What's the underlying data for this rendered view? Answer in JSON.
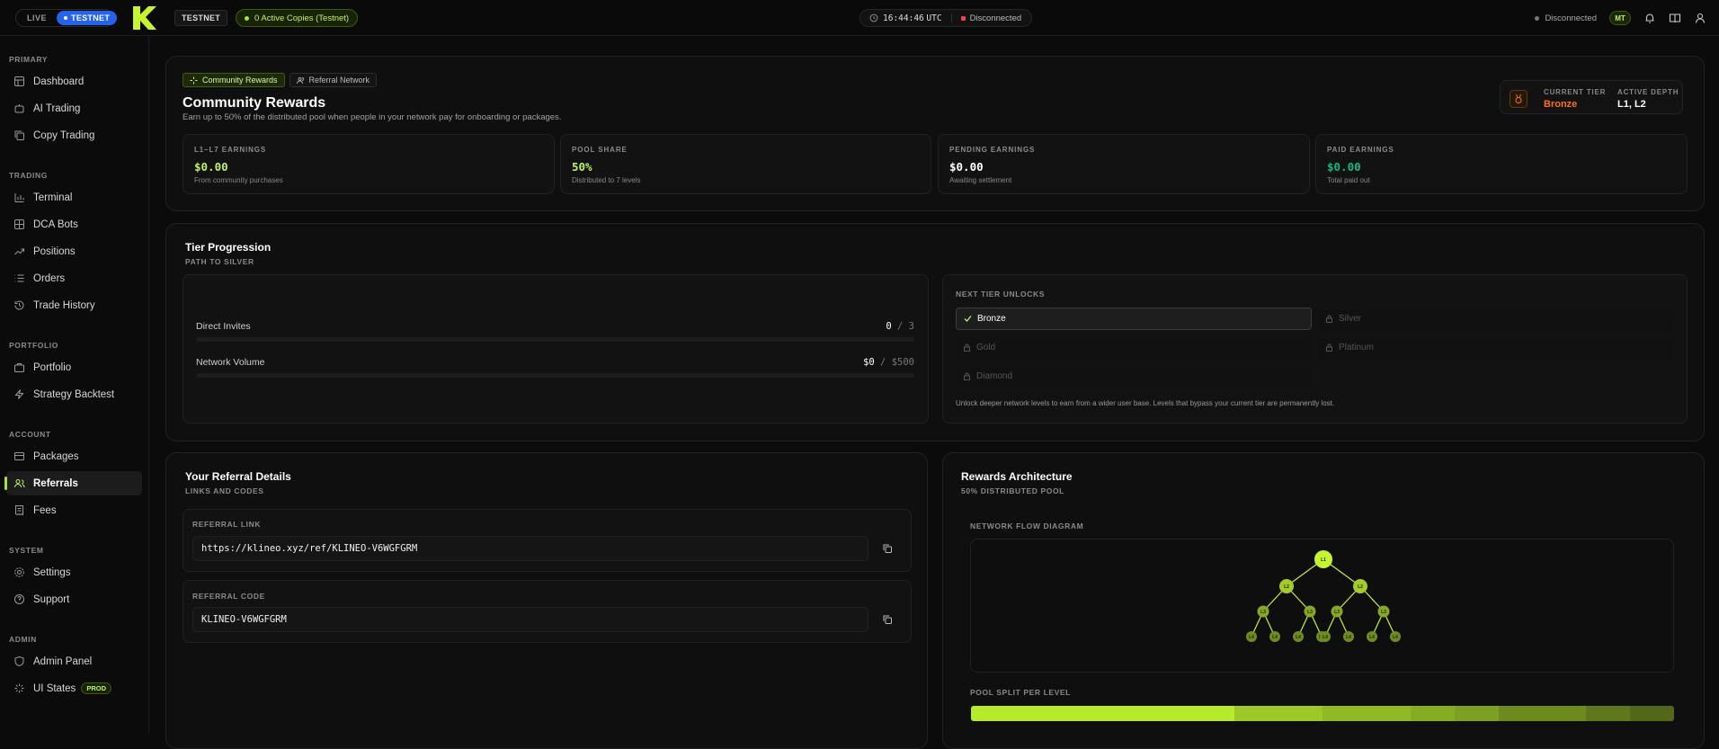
{
  "topbar": {
    "mode_live": "LIVE",
    "mode_testnet": "TESTNET",
    "network_badge": "TESTNET",
    "copies_badge": "0 Active Copies (Testnet)",
    "clock_time": "16:44:46",
    "clock_tz": "UTC",
    "connection": "Disconnected",
    "right_status": "Disconnected",
    "user_badge": "MT"
  },
  "sidebar": {
    "sections": [
      {
        "title": "PRIMARY",
        "items": [
          "Dashboard",
          "AI Trading",
          "Copy Trading"
        ]
      },
      {
        "title": "TRADING",
        "items": [
          "Terminal",
          "DCA Bots",
          "Positions",
          "Orders",
          "Trade History"
        ]
      },
      {
        "title": "PORTFOLIO",
        "items": [
          "Portfolio",
          "Strategy Backtest"
        ]
      },
      {
        "title": "ACCOUNT",
        "items": [
          "Packages",
          "Referrals",
          "Fees"
        ]
      },
      {
        "title": "SYSTEM",
        "items": [
          "Settings",
          "Support"
        ]
      },
      {
        "title": "ADMIN",
        "items": [
          "Admin Panel",
          "UI States"
        ]
      }
    ],
    "active_item": "Referrals",
    "prod_badge": "PROD"
  },
  "header": {
    "tab_community": "Community Rewards",
    "tab_network": "Referral Network",
    "title": "Community Rewards",
    "subtitle": "Earn up to 50% of the distributed pool when people in your network pay for onboarding or packages.",
    "current_tier_label": "CURRENT TIER",
    "current_tier": "Bronze",
    "active_depth_label": "ACTIVE DEPTH",
    "active_depth": "L1, L2"
  },
  "stats": [
    {
      "label": "L1–L7 EARNINGS",
      "value": "$0.00",
      "sub": "From community purchases",
      "color": "#bef264"
    },
    {
      "label": "POOL SHARE",
      "value": "50%",
      "sub": "Distributed to 7 levels",
      "color": "#bef264"
    },
    {
      "label": "PENDING EARNINGS",
      "value": "$0.00",
      "sub": "Awaiting settlement",
      "color": "#ffffff"
    },
    {
      "label": "PAID EARNINGS",
      "value": "$0.00",
      "sub": "Total paid out",
      "color": "#10b981"
    }
  ],
  "tier_progression": {
    "title": "Tier Progression",
    "subtitle": "PATH TO SILVER",
    "direct_invites_label": "Direct Invites",
    "direct_invites_value": "0",
    "direct_invites_target": "3",
    "direct_invites_progress": 0,
    "network_volume_label": "Network Volume",
    "network_volume_value": "$0",
    "network_volume_target": "$500",
    "network_volume_progress": 0,
    "next_unlocks_title": "NEXT TIER UNLOCKS",
    "unlocks": [
      "Bronze",
      "Silver",
      "Gold",
      "Platinum",
      "Diamond"
    ],
    "note": "Unlock deeper network levels to earn from a wider user base. Levels that bypass your current tier are permanently lost."
  },
  "referral": {
    "title": "Your Referral Details",
    "subtitle": "LINKS AND CODES",
    "link_label": "REFERRAL LINK",
    "link_value": "https://klineo.xyz/ref/KLINEO-V6WGFGRM",
    "code_label": "REFERRAL CODE",
    "code_value": "KLINEO-V6WGFGRM"
  },
  "architecture": {
    "title": "Rewards Architecture",
    "subtitle": "50% DISTRIBUTED POOL",
    "diagram_label": "NETWORK FLOW DIAGRAM",
    "split_label": "POOL SPLIT PER LEVEL",
    "nodes": [
      "L1",
      "L2",
      "L2",
      "L3",
      "L3",
      "L3",
      "L3",
      "L4",
      "L4",
      "L4",
      "L4",
      "L4",
      "L4",
      "L4",
      "L4"
    ]
  },
  "colors": {
    "accent": "#a3e635",
    "bronze": "#f97316",
    "paid": "#10b981"
  }
}
